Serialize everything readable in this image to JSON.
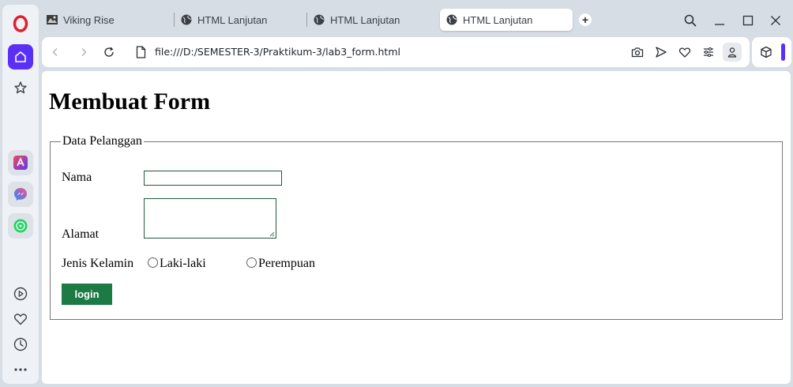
{
  "browser": {
    "tabs": [
      {
        "label": "Viking Rise",
        "icon": "game-icon",
        "active": false
      },
      {
        "label": "HTML Lanjutan",
        "icon": "globe-icon",
        "active": false
      },
      {
        "label": "HTML Lanjutan",
        "icon": "globe-icon",
        "active": false
      },
      {
        "label": "HTML Lanjutan",
        "icon": "globe-icon",
        "active": true
      }
    ],
    "new_tab_symbol": "+",
    "address": "file:///D:/SEMESTER-3/Praktikum-3/lab3_form.html",
    "accent_color": "#5b30f6"
  },
  "sidebar": {
    "items": [
      "opera-logo",
      "home",
      "pinboards-star",
      "aria",
      "messenger",
      "whatsapp",
      "player",
      "my-flow-heart",
      "history",
      "more"
    ]
  },
  "page": {
    "heading": "Membuat Form",
    "fieldset_legend": "Data Pelanggan",
    "nama_label": "Nama",
    "nama_value": "",
    "alamat_label": "Alamat",
    "alamat_value": "",
    "jenis_kelamin_label": "Jenis Kelamin",
    "gender_options": [
      "Laki-laki",
      "Perempuan"
    ],
    "submit_label": "login",
    "button_color": "#1c7a44"
  }
}
